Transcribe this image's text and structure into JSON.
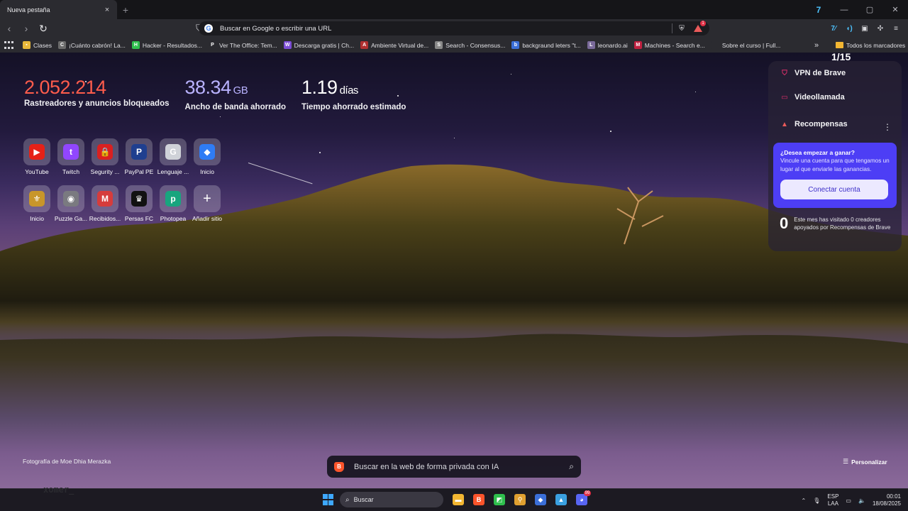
{
  "tab": {
    "title": "Nueva pestaña",
    "close": "×",
    "new_tab": "+"
  },
  "window": {
    "ext_label": "7⁄₅",
    "minimize": "—",
    "maximize": "▢",
    "close": "✕"
  },
  "omnibox": {
    "placeholder": "Buscar en Google o escribir una URL",
    "google_letter": "G",
    "rewards_badge": "1"
  },
  "bookmarks": [
    {
      "label": "Clases",
      "color": "#e8b83a",
      "glyph": "▪"
    },
    {
      "label": "¡Cuánto cabrón! La...",
      "color": "#6b6b6b",
      "glyph": "C"
    },
    {
      "label": "Hacker - Resultados...",
      "color": "#2fbf4d",
      "glyph": "H"
    },
    {
      "label": "Ver The Office: Tem...",
      "color": "#2b2b30",
      "glyph": "P"
    },
    {
      "label": "Descarga gratis | Ch...",
      "color": "#7c4dd6",
      "glyph": "W"
    },
    {
      "label": "Ambiente Virtual de...",
      "color": "#b03030",
      "glyph": "A"
    },
    {
      "label": "Search - Consensus...",
      "color": "#888888",
      "glyph": "S"
    },
    {
      "label": "backgraund leters \"t...",
      "color": "#3b6fd8",
      "glyph": "b"
    },
    {
      "label": "leonardo.ai",
      "color": "#7a6a9a",
      "glyph": "L"
    },
    {
      "label": "Machines - Search e...",
      "color": "#c02040",
      "glyph": "M"
    },
    {
      "label": "Sobre el curso | Full...",
      "color": "#2b2b30",
      "glyph": " "
    }
  ],
  "bookmarks_more": "»",
  "bookmarks_all": "Todos los marcadores",
  "stats": {
    "trackers_value": "2.052.214",
    "trackers_label": "Rastreadores y anuncios bloqueados",
    "bandwidth_value": "38.34",
    "bandwidth_unit": "GB",
    "bandwidth_label": "Ancho de banda ahorrado",
    "time_value": "1.19",
    "time_unit": "días",
    "time_label": "Tiempo ahorrado estimado"
  },
  "top_sites": [
    {
      "name": "YouTube",
      "color": "#e62117",
      "glyph": "▶"
    },
    {
      "name": "Twitch",
      "color": "#9146ff",
      "glyph": "t"
    },
    {
      "name": "Segurity ...",
      "color": "#d92020",
      "glyph": "🔒"
    },
    {
      "name": "PayPal PE",
      "color": "#1f3f8f",
      "glyph": "P"
    },
    {
      "name": "Lenguaje ...",
      "color": "#cfd2d8",
      "glyph": "G"
    },
    {
      "name": "Inicio",
      "color": "#2f7cf5",
      "glyph": "◆"
    },
    {
      "name": "Inicio",
      "color": "#c8962a",
      "glyph": "⚜"
    },
    {
      "name": "Puzzle Ga...",
      "color": "#7a7a80",
      "glyph": "◉"
    },
    {
      "name": "Recibidos...",
      "color": "#d63c3c",
      "glyph": "M"
    },
    {
      "name": "Persas FC",
      "color": "#111111",
      "glyph": "♛"
    },
    {
      "name": "Photopea",
      "color": "#18a57e",
      "glyph": "p"
    },
    {
      "name": "Añadir sitio",
      "color": "transparent",
      "glyph": "+"
    }
  ],
  "widget": {
    "page_count": "1/15",
    "vpn": "VPN de Brave",
    "video": "Videollamada",
    "rewards": "Recompensas",
    "more": "⋮",
    "earn_question": "¿Desea empezar a ganar?",
    "earn_desc": "Vincule una cuenta para que tengamos un lugar al que enviarle las ganancias.",
    "connect_button": "Conectar cuenta",
    "visited_count": "0",
    "visited_text": "Este mes has visitado 0 creadores apoyados por Recompensas de Brave"
  },
  "credit": "Fotografía de Moe Dhia Merazka",
  "ai_search": {
    "placeholder": "Buscar en la web de forma privada con IA"
  },
  "customize": "Personalizar",
  "taskbar": {
    "watermark": "xomer_",
    "search": "Buscar",
    "apps": [
      {
        "name": "file-explorer",
        "color": "#f2b632",
        "glyph": "▬"
      },
      {
        "name": "brave",
        "color": "#fb542b",
        "glyph": "B"
      },
      {
        "name": "app-3",
        "color": "#2fbf4d",
        "glyph": "◩"
      },
      {
        "name": "app-4",
        "color": "#e0a030",
        "glyph": "⚲"
      },
      {
        "name": "app-5",
        "color": "#3b6fd8",
        "glyph": "◆"
      },
      {
        "name": "app-6",
        "color": "#3aa0e0",
        "glyph": "▲"
      },
      {
        "name": "discord",
        "color": "#5865f2",
        "glyph": "◕",
        "badge": "99"
      }
    ],
    "lang_top": "ESP",
    "lang_bottom": "LAA",
    "time": "00:01",
    "date": "18/08/2025"
  }
}
